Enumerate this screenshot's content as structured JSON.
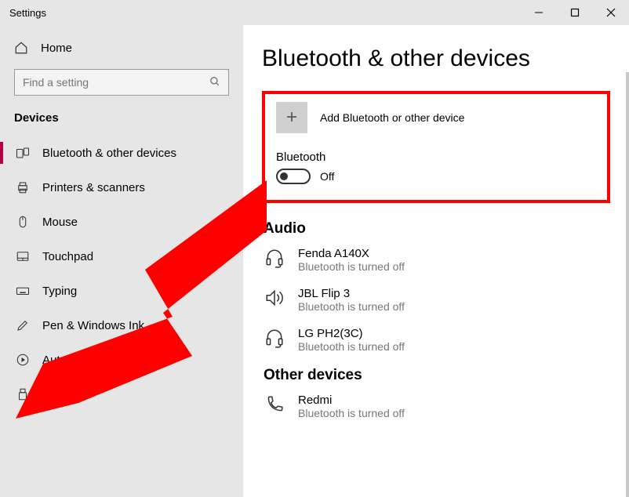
{
  "window": {
    "title": "Settings"
  },
  "sidebar": {
    "home": "Home",
    "search_placeholder": "Find a setting",
    "section": "Devices",
    "items": [
      {
        "label": "Bluetooth & other devices"
      },
      {
        "label": "Printers & scanners"
      },
      {
        "label": "Mouse"
      },
      {
        "label": "Touchpad"
      },
      {
        "label": "Typing"
      },
      {
        "label": "Pen & Windows Ink"
      },
      {
        "label": "AutoPlay"
      },
      {
        "label": "USB"
      }
    ]
  },
  "main": {
    "heading": "Bluetooth & other devices",
    "add_label": "Add Bluetooth or other device",
    "bt_label": "Bluetooth",
    "bt_state": "Off",
    "groups": [
      {
        "title": "Audio",
        "devices": [
          {
            "name": "Fenda A140X",
            "status": "Bluetooth is turned off"
          },
          {
            "name": "JBL Flip 3",
            "status": "Bluetooth is turned off"
          },
          {
            "name": "LG PH2(3C)",
            "status": "Bluetooth is turned off"
          }
        ]
      },
      {
        "title": "Other devices",
        "devices": [
          {
            "name": "Redmi",
            "status": "Bluetooth is turned off"
          }
        ]
      }
    ]
  }
}
